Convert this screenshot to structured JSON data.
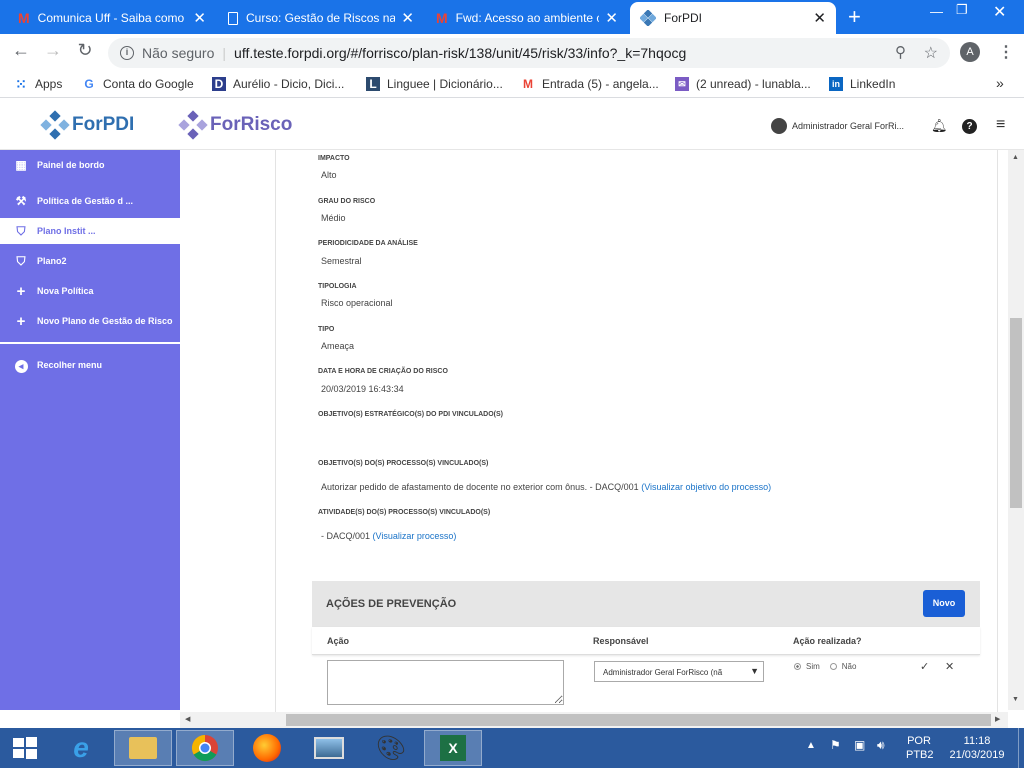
{
  "browser": {
    "tabs": [
      {
        "title": "Comunica Uff - Saiba como",
        "icon": "gmail-icon"
      },
      {
        "title": "Curso: Gestão de Riscos na",
        "icon": "document-icon"
      },
      {
        "title": "Fwd: Acesso ao ambiente c",
        "icon": "gmail-icon"
      },
      {
        "title": "ForPDI",
        "icon": "forpdi-icon"
      }
    ],
    "security_label": "Não seguro",
    "url": "uff.teste.forpdi.org/#/forrisco/plan-risk/138/unit/45/risk/33/info?_k=7hqocg",
    "profile_initial": "A",
    "bookmarks": [
      {
        "label": "Apps",
        "icon": "apps-grid-icon"
      },
      {
        "label": "Conta do Google",
        "icon": "google-icon"
      },
      {
        "label": "Aurélio - Dicio, Dici...",
        "icon": "dicio-icon"
      },
      {
        "label": "Linguee | Dicionário...",
        "icon": "linguee-icon"
      },
      {
        "label": "Entrada (5) - angela...",
        "icon": "gmail-icon"
      },
      {
        "label": "(2 unread) - lunabla...",
        "icon": "mail-icon"
      },
      {
        "label": "LinkedIn",
        "icon": "linkedin-icon"
      }
    ]
  },
  "app": {
    "logo_forpdi": "ForPDI",
    "logo_forrisco": "ForRisco",
    "user_name": "Administrador Geral ForRi...",
    "sidebar": [
      {
        "label": "Painel de bordo",
        "icon": "dashboard-icon"
      },
      {
        "label": "Política de Gestão d ...",
        "icon": "gavel-icon"
      },
      {
        "label": "Plano Instit ...",
        "icon": "shield-icon"
      },
      {
        "label": "Plano2",
        "icon": "shield-icon"
      },
      {
        "label": "Nova Política",
        "icon": "plus-icon"
      },
      {
        "label": "Novo Plano de Gestão de Risco",
        "icon": "plus-icon"
      }
    ],
    "collapse_label": "Recolher menu",
    "fields": [
      {
        "label": "IMPACTO",
        "value": "Alto"
      },
      {
        "label": "GRAU DO RISCO",
        "value": "Médio"
      },
      {
        "label": "PERIODICIDADE DA ANÁLISE",
        "value": "Semestral"
      },
      {
        "label": "TIPOLOGIA",
        "value": "Risco operacional"
      },
      {
        "label": "TIPO",
        "value": "Ameaça"
      },
      {
        "label": "DATA E HORA DE CRIAÇÃO DO RISCO",
        "value": "20/03/2019 16:43:34"
      },
      {
        "label": "OBJETIVO(S) ESTRATÉGICO(S) DO PDI VINCULADO(S)",
        "value": ""
      }
    ],
    "process_objectives": {
      "label": "OBJETIVO(S) DO(S) PROCESSO(S) VINCULADO(S)",
      "text": "Autorizar pedido de afastamento de docente no exterior com ônus. - DACQ/001",
      "link": "(Visualizar objetivo do processo)"
    },
    "process_activities": {
      "label": "ATIVIDADE(S) DO(S) PROCESSO(S) VINCULADO(S)",
      "text": "- DACQ/001",
      "link": "(Visualizar processo)"
    },
    "prevention": {
      "title": "AÇÕES DE PREVENÇÃO",
      "new_button": "Novo",
      "col_action": "Ação",
      "col_responsible": "Responsável",
      "col_done": "Ação realizada?",
      "responsible_value": "Administrador Geral ForRisco (nã",
      "option_yes": "Sim",
      "option_no": "Não"
    }
  },
  "taskbar": {
    "lang": "POR",
    "layout": "PTB2",
    "time": "11:18",
    "date": "21/03/2019"
  },
  "colors": {
    "browser_blue": "#1a73e8",
    "sidebar": "#6f6fe6",
    "primary_button": "#1a5fd6",
    "taskbar": "#2b5a9e"
  }
}
